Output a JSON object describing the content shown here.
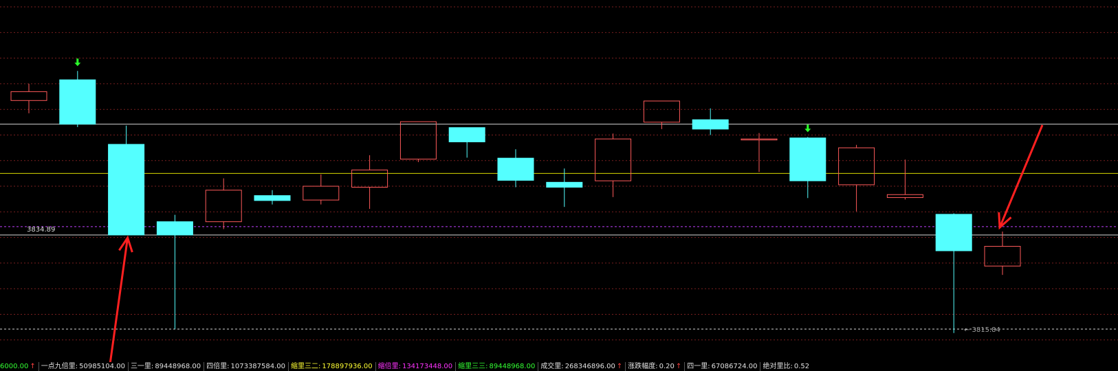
{
  "chart_data": {
    "type": "candlestick",
    "ylim": [
      3811.2,
      3882.6
    ],
    "colors": {
      "up": "#ff5a5a",
      "down": "#54ffff",
      "background": "#000000",
      "grid": "#7a1f1f",
      "marker": "#2bff2b",
      "annotation": "#ff2020"
    },
    "candles": [
      {
        "open": 3862.2,
        "high": 3865.6,
        "low": 3859.6,
        "close": 3864.0
      },
      {
        "open": 3866.4,
        "high": 3868.2,
        "low": 3856.8,
        "close": 3857.4
      },
      {
        "open": 3853.3,
        "high": 3857.1,
        "low": 3834.9,
        "close": 3834.9
      },
      {
        "open": 3837.6,
        "high": 3839.0,
        "low": 3815.8,
        "close": 3834.9
      },
      {
        "open": 3837.6,
        "high": 3846.4,
        "low": 3836.1,
        "close": 3844.0
      },
      {
        "open": 3842.9,
        "high": 3844.0,
        "low": 3841.1,
        "close": 3841.9
      },
      {
        "open": 3842.0,
        "high": 3847.2,
        "low": 3841.1,
        "close": 3844.8
      },
      {
        "open": 3844.6,
        "high": 3851.1,
        "low": 3840.2,
        "close": 3848.1
      },
      {
        "open": 3850.3,
        "high": 3857.9,
        "low": 3849.7,
        "close": 3857.9
      },
      {
        "open": 3856.7,
        "high": 3856.7,
        "low": 3850.6,
        "close": 3853.8
      },
      {
        "open": 3850.5,
        "high": 3852.3,
        "low": 3844.6,
        "close": 3846.0
      },
      {
        "open": 3845.6,
        "high": 3848.4,
        "low": 3840.6,
        "close": 3844.6
      },
      {
        "open": 3845.9,
        "high": 3855.5,
        "low": 3842.6,
        "close": 3854.4
      },
      {
        "open": 3857.8,
        "high": 3862.1,
        "low": 3856.4,
        "close": 3862.1
      },
      {
        "open": 3858.3,
        "high": 3860.6,
        "low": 3855.2,
        "close": 3856.4
      },
      {
        "open": 3854.4,
        "high": 3855.6,
        "low": 3847.7,
        "close": 3854.4
      },
      {
        "open": 3854.6,
        "high": 3854.8,
        "low": 3842.4,
        "close": 3845.9
      },
      {
        "open": 3845.1,
        "high": 3853.2,
        "low": 3839.7,
        "close": 3852.6
      },
      {
        "open": 3842.5,
        "high": 3850.2,
        "low": 3842.1,
        "close": 3843.1
      },
      {
        "open": 3839.1,
        "high": 3839.3,
        "low": 3815.0,
        "close": 3831.7
      },
      {
        "open": 3828.6,
        "high": 3835.6,
        "low": 3826.8,
        "close": 3832.6
      }
    ],
    "reference_lines": [
      {
        "value": 3857.4,
        "color": "#d8d8d8",
        "style": "solid"
      },
      {
        "value": 3847.4,
        "color": "#d8d800",
        "style": "solid"
      },
      {
        "value": 3836.6,
        "color": "#c040ff",
        "style": "dashed"
      },
      {
        "value": 3834.9,
        "color": "#d8d8d8",
        "style": "solid"
      },
      {
        "value": 3815.8,
        "color": "#d8d8d8",
        "style": "dashed"
      }
    ],
    "grid": true,
    "price_labels": [
      {
        "text": "3834.89",
        "value": 3834.9,
        "color": "#d8d8d8"
      },
      {
        "text": "3815.84",
        "value": 3815.8,
        "color": "#a0a0a0"
      }
    ],
    "markers": [
      {
        "candle": 1,
        "type": "down-arrow"
      },
      {
        "candle": 16,
        "type": "down-arrow"
      }
    ],
    "annotation_arrows": [
      {
        "candle": 2,
        "value": 3834.9
      },
      {
        "candle": 20,
        "value": 3835.6
      }
    ]
  },
  "status_bar": [
    {
      "label": "",
      "value": "6000.00",
      "arrow": "↑",
      "label_color": "#ff4040",
      "value_color": "#33ff33",
      "arrow_color": "#ff4040"
    },
    {
      "label": "一点九倍里:",
      "value": "50985104.00",
      "arrow": "",
      "label_color": "#e0e0e0",
      "value_color": "#e0e0e0",
      "arrow_color": "#e0e0e0"
    },
    {
      "label": "三一里:",
      "value": "89448968.00",
      "arrow": "",
      "label_color": "#e0e0e0",
      "value_color": "#e0e0e0",
      "arrow_color": "#e0e0e0"
    },
    {
      "label": "四倍里:",
      "value": "1073387584.00",
      "arrow": "",
      "label_color": "#e0e0e0",
      "value_color": "#e0e0e0",
      "arrow_color": "#e0e0e0"
    },
    {
      "label": "缩里三二:",
      "value": "178897936.00",
      "arrow": "",
      "label_color": "#ffff33",
      "value_color": "#ffff33",
      "arrow_color": "#ffff33"
    },
    {
      "label": "缩倍里:",
      "value": "134173448.00",
      "arrow": "",
      "label_color": "#ff33ff",
      "value_color": "#ff33ff",
      "arrow_color": "#ff33ff"
    },
    {
      "label": "缩里三三:",
      "value": "89448968.00",
      "arrow": "",
      "label_color": "#33ff33",
      "value_color": "#33ff33",
      "arrow_color": "#33ff33"
    },
    {
      "label": "成交里:",
      "value": "268346896.00",
      "arrow": "↑",
      "label_color": "#e0e0e0",
      "value_color": "#e0e0e0",
      "arrow_color": "#ff4040"
    },
    {
      "label": "涨跌幅度:",
      "value": "0.20",
      "arrow": "↑",
      "label_color": "#e0e0e0",
      "value_color": "#e0e0e0",
      "arrow_color": "#ff4040"
    },
    {
      "label": "四一里:",
      "value": "67086724.00",
      "arrow": "",
      "label_color": "#e0e0e0",
      "value_color": "#e0e0e0",
      "arrow_color": "#e0e0e0"
    },
    {
      "label": "绝对里比:",
      "value": "0.52",
      "arrow": "",
      "label_color": "#e0e0e0",
      "value_color": "#e0e0e0",
      "arrow_color": "#e0e0e0"
    }
  ]
}
